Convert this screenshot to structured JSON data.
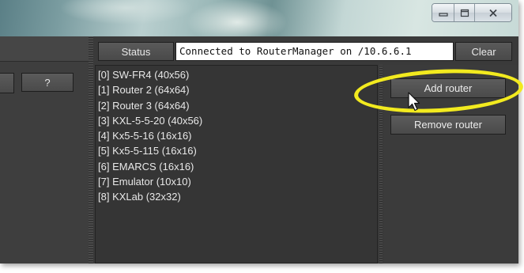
{
  "window": {
    "controls": {
      "minimize_icon": "minimize-icon",
      "maximize_icon": "maximize-icon",
      "close_icon": "close-icon"
    }
  },
  "left_panel": {
    "help_label": "?"
  },
  "status_bar": {
    "label": "Status",
    "value": "Connected to RouterManager on /10.6.6.1",
    "clear_label": "Clear"
  },
  "routers": [
    "[0] SW-FR4 (40x56)",
    "[1] Router 2 (64x64)",
    "[2] Router 3 (64x64)",
    "[3] KXL-5-5-20 (40x56)",
    "[4] Kx5-5-16 (16x16)",
    "[5] Kx5-5-115 (16x16)",
    "[6] EMARCS (16x16)",
    "[7] Emulator (10x10)",
    "[8] KXLab (32x32)"
  ],
  "actions": {
    "add_label": "Add router",
    "remove_label": "Remove router"
  },
  "colors": {
    "highlight": "#f2ea1f",
    "panel_bg": "#3a3a3a",
    "text": "#e8e8e8"
  }
}
